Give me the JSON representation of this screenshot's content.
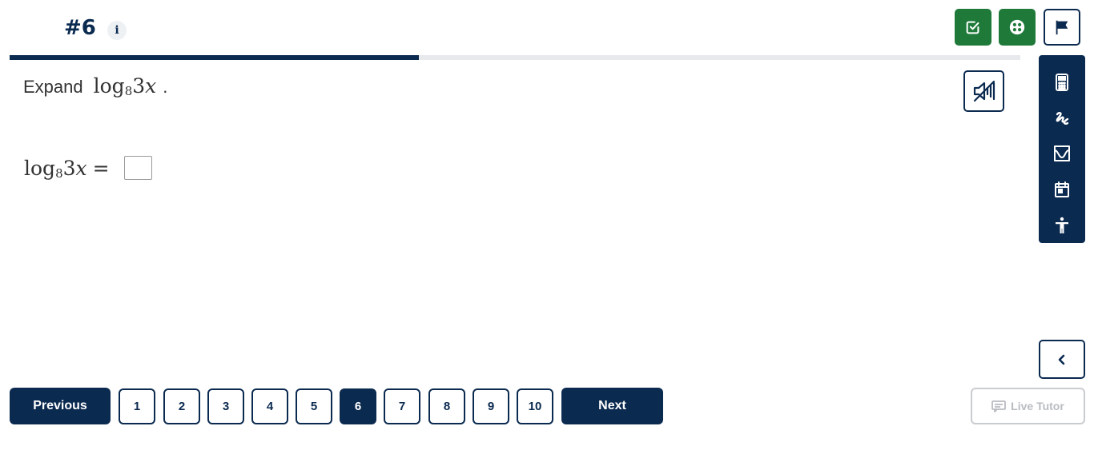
{
  "header": {
    "question_number": "#6",
    "info_label": "i"
  },
  "progress": {
    "percent": 40.5
  },
  "question": {
    "prompt_word": "Expand",
    "expression": {
      "func": "log",
      "base": "8",
      "coef": "3",
      "var": "x"
    },
    "period": ".",
    "answer": {
      "equals": "=",
      "value": ""
    }
  },
  "top_buttons": [
    {
      "name": "checklist-button",
      "icon": "checkbox-check-icon",
      "style": "green"
    },
    {
      "name": "options-button",
      "icon": "dots-circle-icon",
      "style": "green"
    },
    {
      "name": "flag-button",
      "icon": "flag-icon",
      "style": "outline"
    }
  ],
  "mute_icon": "speaker-muted-icon",
  "toolbar": [
    {
      "name": "calculator",
      "icon": "calculator-icon"
    },
    {
      "name": "scribble",
      "icon": "scribble-icon"
    },
    {
      "name": "graph",
      "icon": "graph-icon"
    },
    {
      "name": "calendar",
      "icon": "calendar-icon"
    },
    {
      "name": "accessibility",
      "icon": "accessibility-icon"
    }
  ],
  "navigation": {
    "previous_label": "Previous",
    "next_label": "Next",
    "pages": [
      "1",
      "2",
      "3",
      "4",
      "5",
      "6",
      "7",
      "8",
      "9",
      "10"
    ],
    "current_page": "6"
  },
  "live_tutor": {
    "label": "Live Tutor",
    "enabled": false
  },
  "colors": {
    "navy": "#0b2a50",
    "green": "#1f7a3a",
    "progress_track": "#e7e9ec",
    "disabled": "#b8bcc1"
  }
}
